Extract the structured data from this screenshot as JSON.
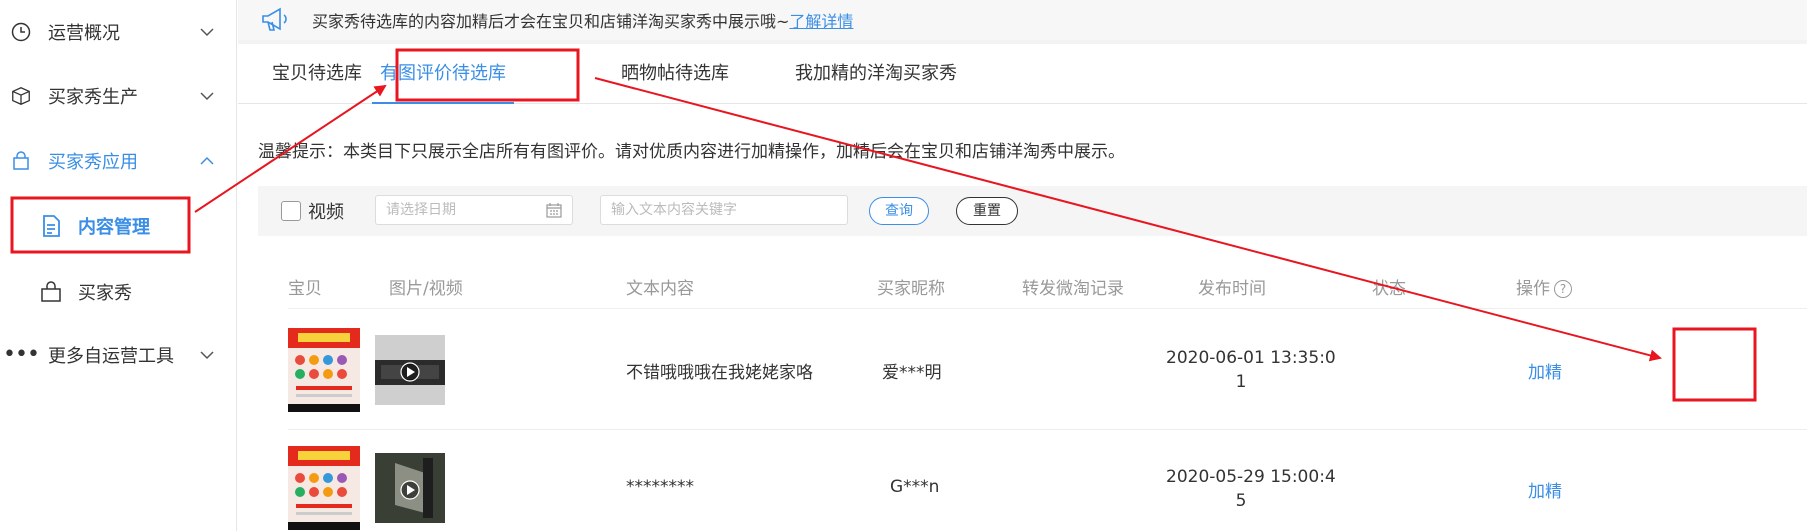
{
  "sidebar": {
    "items": [
      {
        "label": "运营概况",
        "icon": "clock-icon"
      },
      {
        "label": "买家秀生产",
        "icon": "package-icon"
      },
      {
        "label": "买家秀应用",
        "icon": "bag-icon"
      },
      {
        "label": "更多自运营工具",
        "icon": "more-icon"
      }
    ],
    "subitems": [
      {
        "label": "内容管理",
        "icon": "document-icon"
      },
      {
        "label": "买家秀",
        "icon": "shopping-bag-icon"
      }
    ]
  },
  "notice": {
    "text": "买家秀待选库的内容加精后才会在宝贝和店铺洋淘买家秀中展示哦~",
    "link": "了解详情"
  },
  "tabs": [
    {
      "label": "宝贝待选库"
    },
    {
      "label": "有图评价待选库"
    },
    {
      "label": "晒物帖待选库"
    },
    {
      "label": "我加精的洋淘买家秀"
    }
  ],
  "tip": "温馨提示：本类目下只展示全店所有有图评价。请对优质内容进行加精操作，加精后会在宝贝和店铺洋淘秀中展示。",
  "filter": {
    "video_label": "视频",
    "date_placeholder": "请选择日期",
    "keyword_placeholder": "输入文本内容关键字",
    "query_label": "查询",
    "reset_label": "重置"
  },
  "table": {
    "headers": [
      "宝贝",
      "图片/视频",
      "文本内容",
      "买家昵称",
      "转发微淘记录",
      "发布时间",
      "状态",
      "操作"
    ],
    "rows": [
      {
        "text": "不错哦哦哦在我姥姥家咯",
        "buyer": "爱***明",
        "time_line1": "2020-06-01 13:35:0",
        "time_line2": "1",
        "action": "加精"
      },
      {
        "text": "********",
        "buyer": "G***n",
        "time_line1": "2020-05-29 15:00:4",
        "time_line2": "5",
        "action": "加精"
      }
    ]
  },
  "colors": {
    "accent": "#3a8ee6",
    "annotation": "#e8161f"
  }
}
